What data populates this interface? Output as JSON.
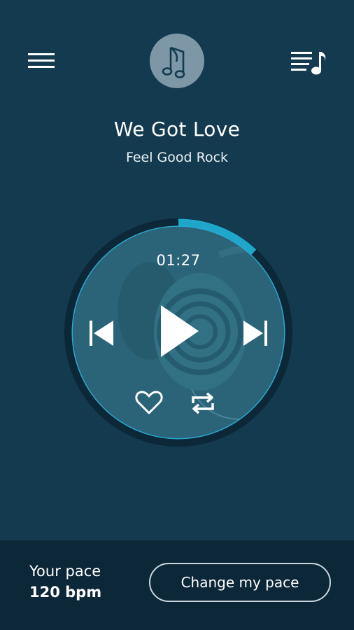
{
  "header": {
    "menu_icon": "hamburger-menu-icon",
    "logo_icon": "music-notes-icon",
    "queue_icon": "playlist-music-icon"
  },
  "song": {
    "title": "We Got Love",
    "genre": "Feel Good Rock"
  },
  "player": {
    "elapsed": "01:27",
    "progress_fraction": 0.12,
    "accent_color": "#1fa6cb",
    "controls": {
      "previous_icon": "skip-previous-icon",
      "play_icon": "play-icon",
      "next_icon": "skip-next-icon",
      "like_icon": "heart-icon",
      "repeat_icon": "repeat-icon"
    }
  },
  "pace": {
    "label": "Your pace",
    "value": "120 bpm",
    "button_label": "Change my pace"
  }
}
